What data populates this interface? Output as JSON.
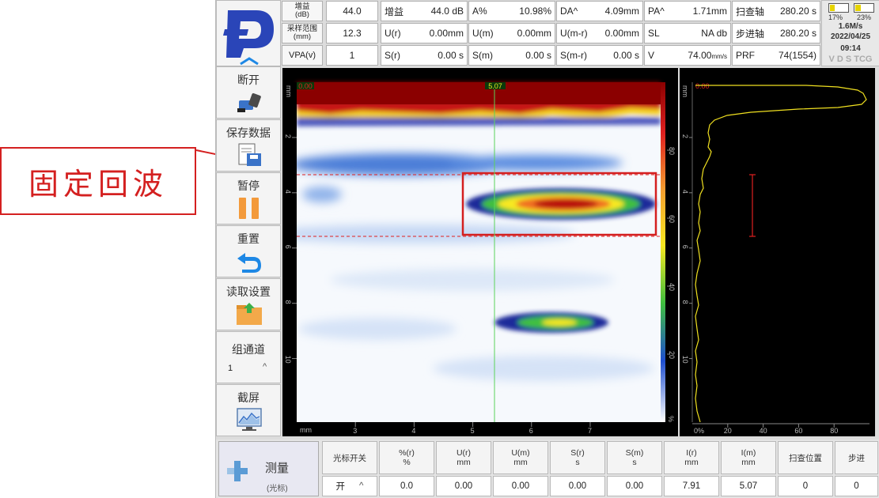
{
  "annotation": {
    "label": "固定回波"
  },
  "header": {
    "row1": {
      "gain_label": "增益",
      "gain_unit": "(dB)",
      "gain_value": "44.0",
      "m": [
        {
          "key": "增益",
          "value": "44.0",
          "unit": "dB"
        },
        {
          "key": "A%",
          "value": "10.98%",
          "unit": ""
        },
        {
          "key": "DA^",
          "value": "4.09",
          "unit": "mm"
        },
        {
          "key": "PA^",
          "value": "1.71",
          "unit": "mm"
        },
        {
          "key": "扫查轴",
          "value": "280.20 s",
          "unit": ""
        }
      ]
    },
    "row2": {
      "range_label": "采样范围",
      "range_unit": "(mm)",
      "range_value": "12.3",
      "m": [
        {
          "key": "U(r)",
          "value": "0.00",
          "unit": "mm"
        },
        {
          "key": "U(m)",
          "value": "0.00",
          "unit": "mm"
        },
        {
          "key": "U(m-r)",
          "value": "0.00",
          "unit": "mm"
        },
        {
          "key": "SL",
          "value": "NA",
          "unit": "db"
        },
        {
          "key": "步进轴",
          "value": "280.20 s",
          "unit": ""
        }
      ]
    },
    "row3": {
      "vpa_label": "VPA(v)",
      "vpa_value": "1",
      "m": [
        {
          "key": "S(r)",
          "value": "0.00",
          "unit": "s"
        },
        {
          "key": "S(m)",
          "value": "0.00",
          "unit": "s"
        },
        {
          "key": "S(m-r)",
          "value": "0.00",
          "unit": "s"
        },
        {
          "key": "V",
          "value": "74.00",
          "unit": "mm/s"
        },
        {
          "key": "PRF",
          "value": "74(1554)",
          "unit": ""
        }
      ]
    }
  },
  "status": {
    "battery1": "17%",
    "battery2": "23%",
    "battery1_level": 0.17,
    "battery2_level": 0.23,
    "speed": "1.6M/s",
    "date": "2022/04/25",
    "time": "09:14",
    "flags": "V D S TCG"
  },
  "menu": [
    {
      "label": "断开",
      "icon": "probe-icon"
    },
    {
      "label": "保存数据",
      "icon": "save-data-icon"
    },
    {
      "label": "暂停",
      "icon": "pause-icon"
    },
    {
      "label": "重置",
      "icon": "undo-icon"
    },
    {
      "label": "读取设置",
      "icon": "folder-icon"
    },
    {
      "label": "组通道",
      "icon": "",
      "value": "1"
    },
    {
      "label": "截屏",
      "icon": "screenshot-icon"
    }
  ],
  "bscan": {
    "cursor_top": "5.07",
    "cursor_left": "0.00",
    "y_ticks": [
      "2",
      "4",
      "6",
      "8",
      "10"
    ],
    "y_unit": "mm",
    "x_ticks": [
      "3",
      "4",
      "5",
      "6",
      "7"
    ],
    "x_unit": "mm",
    "cb_ticks": [
      "80",
      "60",
      "40",
      "20"
    ],
    "cb_unit": "%"
  },
  "ascan": {
    "cursor": "0.00",
    "y_ticks": [
      "2",
      "4",
      "6",
      "8",
      "10"
    ],
    "x_ticks": [
      "20",
      "40",
      "60",
      "80"
    ],
    "x_origin": "0%",
    "y_unit": "mm"
  },
  "bottom": {
    "measure_label": "测量",
    "measure_sub": "(光标)",
    "cols": [
      {
        "head": "光标开关",
        "unit": "",
        "value": "开"
      },
      {
        "head": "%(r)",
        "unit": "%",
        "value": "0.0"
      },
      {
        "head": "U(r)",
        "unit": "mm",
        "value": "0.00"
      },
      {
        "head": "U(m)",
        "unit": "mm",
        "value": "0.00"
      },
      {
        "head": "S(r)",
        "unit": "s",
        "value": "0.00"
      },
      {
        "head": "S(m)",
        "unit": "s",
        "value": "0.00"
      },
      {
        "head": "I(r)",
        "unit": "mm",
        "value": "7.91"
      },
      {
        "head": "I(m)",
        "unit": "mm",
        "value": "5.07"
      },
      {
        "head": "扫查位置",
        "unit": "",
        "value": "0"
      },
      {
        "head": "步进",
        "unit": "",
        "value": "0"
      }
    ]
  }
}
